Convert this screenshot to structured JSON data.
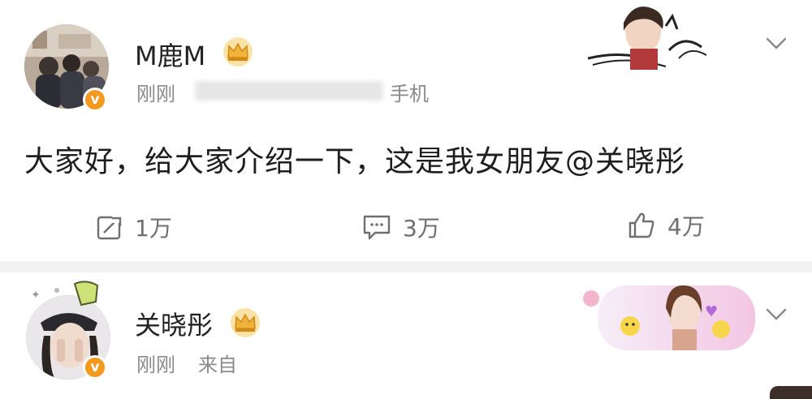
{
  "post1": {
    "username": "M鹿M",
    "time": "刚刚",
    "source": "手机",
    "badge_letter": "v",
    "text": "大家好，给大家介绍一下，这是我女朋友",
    "mention": "@关晓彤",
    "actions": [
      {
        "icon": "repost-icon",
        "count": "1万"
      },
      {
        "icon": "comment-icon",
        "count": "3万"
      },
      {
        "icon": "like-icon",
        "count": "4万"
      }
    ]
  },
  "post2": {
    "username": "关晓彤",
    "time": "刚刚",
    "source": "来自",
    "badge_letter": "v"
  },
  "colors": {
    "background": "#f2f2f2",
    "card": "#ffffff",
    "vip_badge": "#f39a1e",
    "crown": "#f0b23a",
    "meta_text": "#8a8a8a"
  }
}
